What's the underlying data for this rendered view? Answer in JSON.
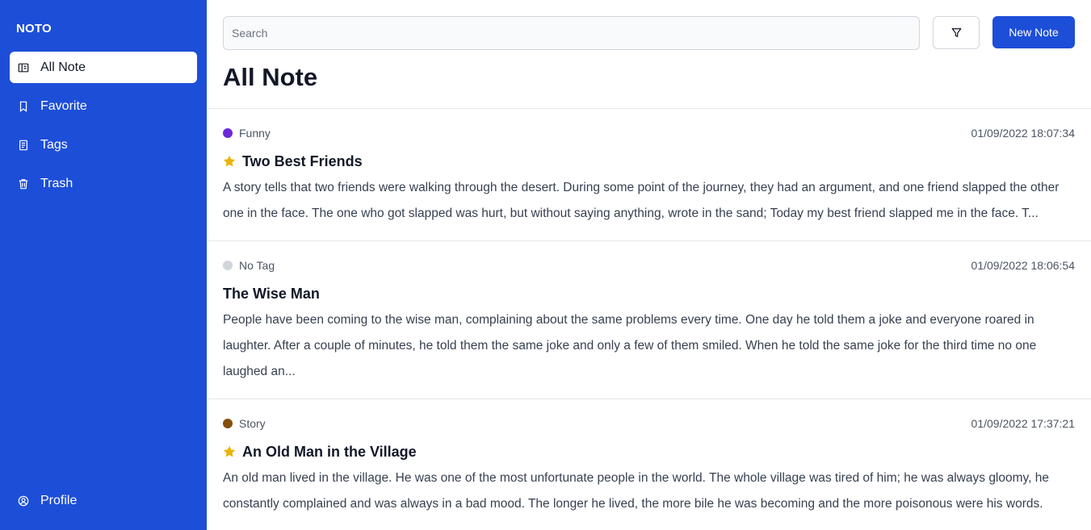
{
  "app": {
    "logo": "NOTO"
  },
  "sidebar": {
    "items": [
      {
        "label": "All Note",
        "icon": "notebook-icon",
        "active": true
      },
      {
        "label": "Favorite",
        "icon": "bookmark-icon",
        "active": false
      },
      {
        "label": "Tags",
        "icon": "tags-icon",
        "active": false
      },
      {
        "label": "Trash",
        "icon": "trash-icon",
        "active": false
      }
    ],
    "profile_label": "Profile"
  },
  "toolbar": {
    "search_placeholder": "Search",
    "filter_icon": "filter-icon",
    "new_note_label": "New Note"
  },
  "main": {
    "title": "All Note"
  },
  "notes": [
    {
      "tag": "Funny",
      "tag_color": "#6d28d9",
      "date": "01/09/2022 18:07:34",
      "favorite": true,
      "title": "Two Best Friends",
      "body": "A story tells that two friends were walking through the desert. During some point of the journey, they had an argument, and one friend slapped the other one in the face. The one who got slapped was hurt, but without saying anything, wrote in the sand; Today my best friend slapped me in the face. T..."
    },
    {
      "tag": "No Tag",
      "tag_color": "#d1d5db",
      "date": "01/09/2022 18:06:54",
      "favorite": false,
      "title": "The Wise Man",
      "body": "People have been coming to the wise man, complaining about the same problems every time. One day he told them a joke and everyone roared in laughter. After a couple of minutes, he told them the same joke and only a few of them smiled. When he told the same joke for the third time no one laughed an..."
    },
    {
      "tag": "Story",
      "tag_color": "#854d0e",
      "date": "01/09/2022 17:37:21",
      "favorite": true,
      "title": "An Old Man in the Village",
      "body": "An old man lived in the village. He was one of the most unfortunate people in the world. The whole village was tired of him; he was always gloomy, he constantly complained and was always in a bad mood. The longer he lived, the more bile he was becoming and the more poisonous were his words."
    }
  ],
  "colors": {
    "primary": "#1d4ed8",
    "star": "#eab308"
  }
}
